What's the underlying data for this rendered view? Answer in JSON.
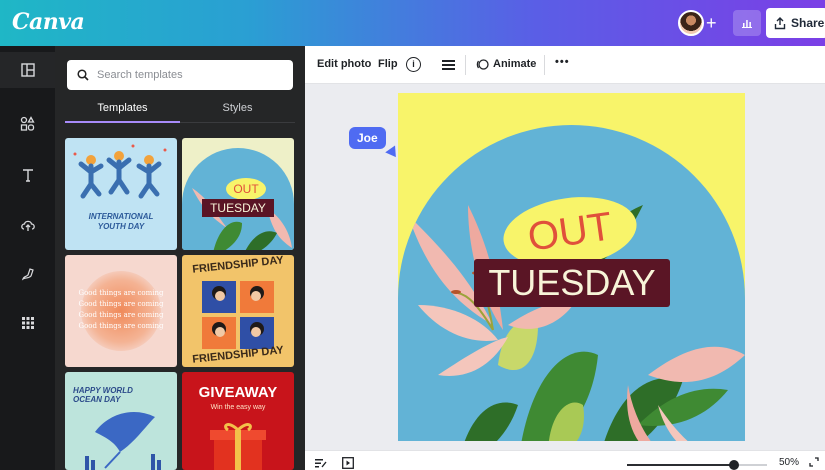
{
  "app": {
    "logo": "Canva"
  },
  "topbar": {
    "plus_label": "+",
    "share_label": "Share"
  },
  "rail": {
    "icons": [
      "design-icon",
      "elements-icon",
      "text-icon",
      "uploads-icon",
      "draw-icon",
      "apps-icon"
    ]
  },
  "panel": {
    "search_placeholder": "Search templates",
    "tabs": [
      "Templates",
      "Styles"
    ],
    "active_tab": "Templates",
    "templates": [
      {
        "lines": [
          "INTERNATIONAL",
          "YOUTH DAY"
        ]
      },
      {
        "lines": [
          "OUT",
          "TUESDAY"
        ]
      },
      {
        "lines": [
          "Good things are coming",
          "Good things are coming",
          "Good things are coming",
          "Good things are coming"
        ]
      },
      {
        "lines": [
          "FRIENDSHIP DAY",
          "FRIENDSHIP DAY"
        ]
      },
      {
        "lines": [
          "HAPPY WORLD",
          "OCEAN DAY"
        ]
      },
      {
        "lines": [
          "GIVEAWAY",
          "Win the easy way"
        ]
      }
    ]
  },
  "toolbar": {
    "edit_photo": "Edit photo",
    "flip": "Flip",
    "info": "i",
    "animate": "Animate",
    "more": "•••"
  },
  "design": {
    "line1": "OUT",
    "line2": "TUESDAY"
  },
  "collaborator": {
    "name": "Joe"
  },
  "bottombar": {
    "zoom_percent": 50,
    "zoom_label": "50%"
  },
  "colors": {
    "accent": "#a78bfa",
    "collaborator": "#4f6bf2",
    "design_bg": "#f8f46a",
    "sky": "#62b3d6",
    "tuesday_bg": "#5a1525"
  }
}
